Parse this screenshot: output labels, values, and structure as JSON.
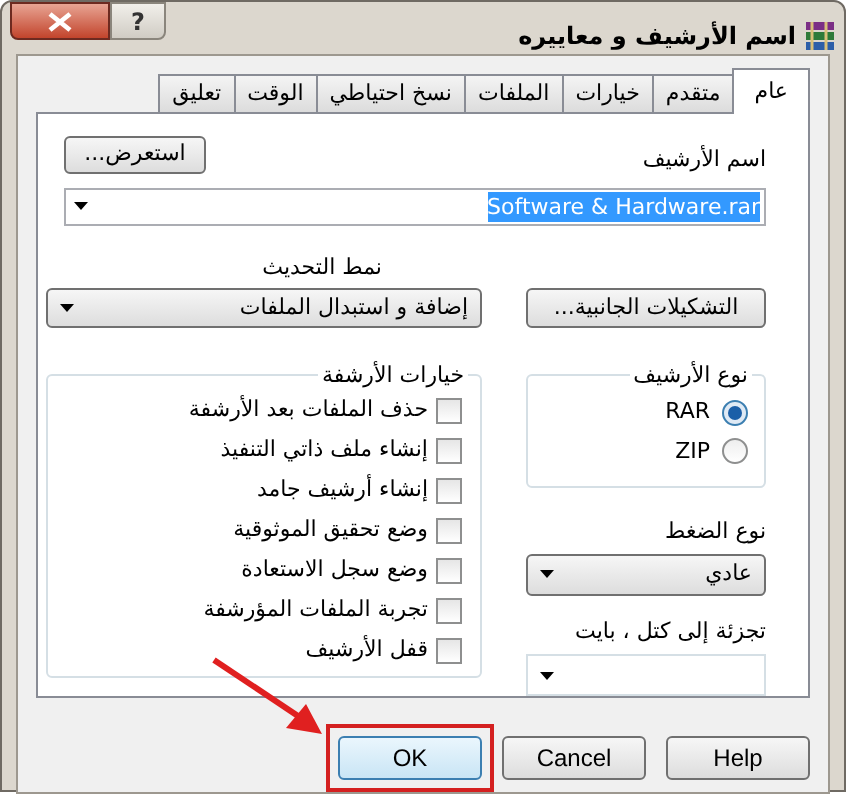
{
  "window": {
    "title": "اسم الأرشيف و معاييره",
    "help_button": "?"
  },
  "tabs": [
    {
      "label": "عام",
      "selected": true
    },
    {
      "label": "متقدم",
      "selected": false
    },
    {
      "label": "خيارات",
      "selected": false
    },
    {
      "label": "الملفات",
      "selected": false
    },
    {
      "label": "نسخ احتياطي",
      "selected": false
    },
    {
      "label": "الوقت",
      "selected": false
    },
    {
      "label": "تعليق",
      "selected": false
    }
  ],
  "archive_name": {
    "label": "اسم الأرشيف",
    "value": "Software & Hardware.rar",
    "browse_button": "استعرض..."
  },
  "update_mode": {
    "label": "نمط التحديث",
    "value": "إضافة و استبدال الملفات"
  },
  "profiles_button": "التشكيلات الجانبية...",
  "archive_options": {
    "title": "خيارات الأرشفة",
    "options": [
      {
        "label": "حذف الملفات بعد الأرشفة",
        "checked": false
      },
      {
        "label": "إنشاء ملف ذاتي التنفيذ",
        "checked": false
      },
      {
        "label": "إنشاء أرشيف جامد",
        "checked": false
      },
      {
        "label": "وضع تحقيق الموثوقية",
        "checked": false
      },
      {
        "label": "وضع سجل الاستعادة",
        "checked": false
      },
      {
        "label": "تجربة الملفات المؤرشفة",
        "checked": false
      },
      {
        "label": "قفل الأرشيف",
        "checked": false
      }
    ]
  },
  "archive_format": {
    "title": "نوع الأرشيف",
    "options": [
      {
        "label": "RAR",
        "selected": true
      },
      {
        "label": "ZIP",
        "selected": false
      }
    ]
  },
  "compression": {
    "label": "نوع الضغط",
    "value": "عادي"
  },
  "split": {
    "label": "تجزئة إلى كتل ، بايت"
  },
  "buttons": [
    {
      "label": "Help",
      "highlighted": false
    },
    {
      "label": "Cancel",
      "highlighted": false
    },
    {
      "label": "OK",
      "highlighted": true
    }
  ]
}
